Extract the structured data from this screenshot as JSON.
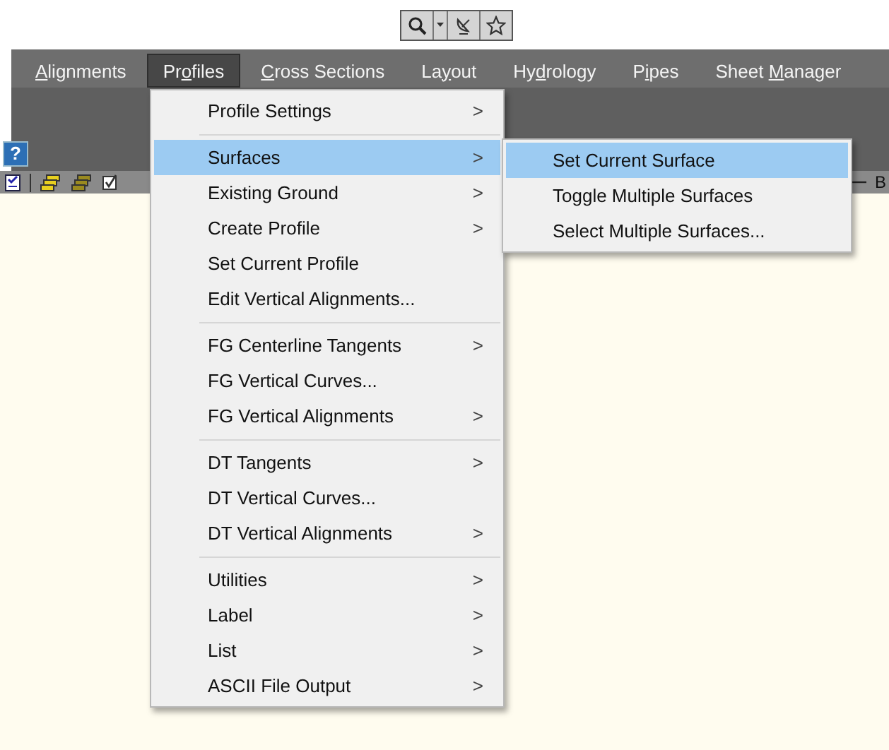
{
  "help_glyph": "?",
  "menu_bar": [
    {
      "access_key": "A",
      "after": "lignments",
      "selected": false
    },
    {
      "before": "Pr",
      "access_key": "o",
      "after": "files",
      "selected": true
    },
    {
      "access_key": "C",
      "after": "ross Sections",
      "selected": false
    },
    {
      "before": "La",
      "access_key": "y",
      "after": "out",
      "selected": false
    },
    {
      "before": "Hy",
      "access_key": "d",
      "after": "rology",
      "selected": false
    },
    {
      "before": "P",
      "access_key": "i",
      "after": "pes",
      "selected": false
    },
    {
      "before": "Sheet ",
      "access_key": "M",
      "after": "anager",
      "selected": false
    }
  ],
  "toolbar_fragment": "B",
  "dropdown": {
    "sections": [
      [
        {
          "label": "Profile Settings",
          "arrow": ">",
          "selected": false
        }
      ],
      [
        {
          "label": "Surfaces",
          "arrow": ">",
          "selected": true
        },
        {
          "label": "Existing Ground",
          "arrow": ">",
          "selected": false
        },
        {
          "label": "Create Profile",
          "arrow": ">",
          "selected": false
        },
        {
          "label": "Set Current Profile",
          "selected": false
        },
        {
          "label": "Edit Vertical Alignments...",
          "selected": false
        }
      ],
      [
        {
          "label": "FG Centerline Tangents",
          "arrow": ">",
          "selected": false
        },
        {
          "label": "FG Vertical Curves...",
          "selected": false
        },
        {
          "label": "FG Vertical Alignments",
          "arrow": ">",
          "selected": false
        }
      ],
      [
        {
          "label": "DT Tangents",
          "arrow": ">",
          "selected": false
        },
        {
          "label": "DT Vertical Curves...",
          "selected": false
        },
        {
          "label": "DT Vertical Alignments",
          "arrow": ">",
          "selected": false
        }
      ],
      [
        {
          "label": "Utilities",
          "arrow": ">",
          "selected": false
        },
        {
          "label": "Label",
          "arrow": ">",
          "selected": false
        },
        {
          "label": "List",
          "arrow": ">",
          "selected": false
        },
        {
          "label": "ASCII File Output",
          "arrow": ">",
          "selected": false
        }
      ]
    ]
  },
  "submenu": {
    "items": [
      {
        "label": "Set Current Surface",
        "selected": true
      },
      {
        "label": "Toggle Multiple Surfaces",
        "selected": false
      },
      {
        "label": "Select Multiple Surfaces...",
        "selected": false
      }
    ]
  }
}
